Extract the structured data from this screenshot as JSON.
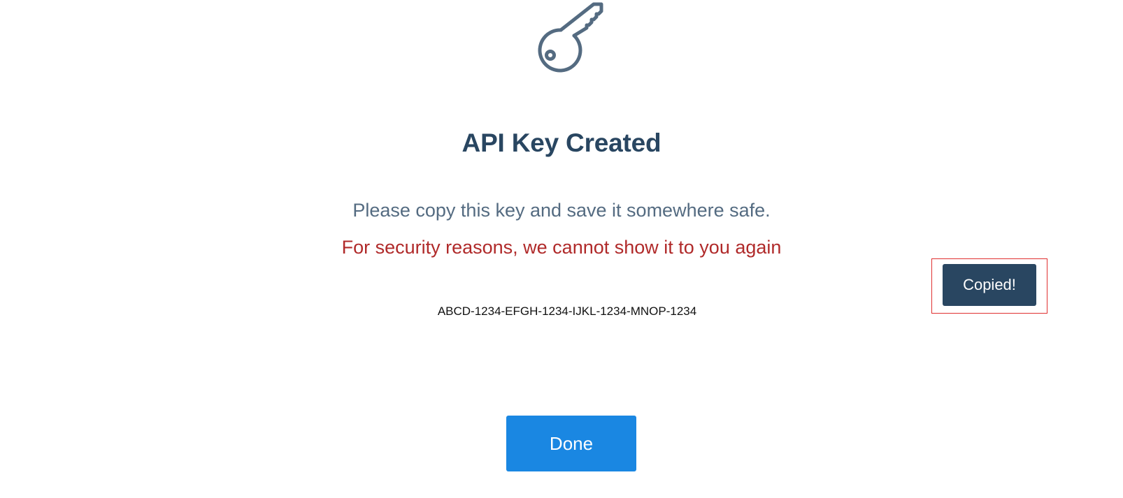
{
  "dialog": {
    "icon": "key-icon",
    "title": "API Key Created",
    "instruction": "Please copy this key and save it somewhere safe.",
    "warning": "For security reasons, we cannot show it to you again",
    "api_key": "ABCD-1234-EFGH-1234-IJKL-1234-MNOP-1234",
    "copy_button_label": "Copied!",
    "done_button_label": "Done"
  },
  "colors": {
    "title": "#294661",
    "instruction": "#546b81",
    "warning": "#b02a2a",
    "copy_button_bg": "#294661",
    "done_button_bg": "#1a87e2",
    "highlight_border": "#e03030",
    "icon_stroke": "#546b81"
  }
}
